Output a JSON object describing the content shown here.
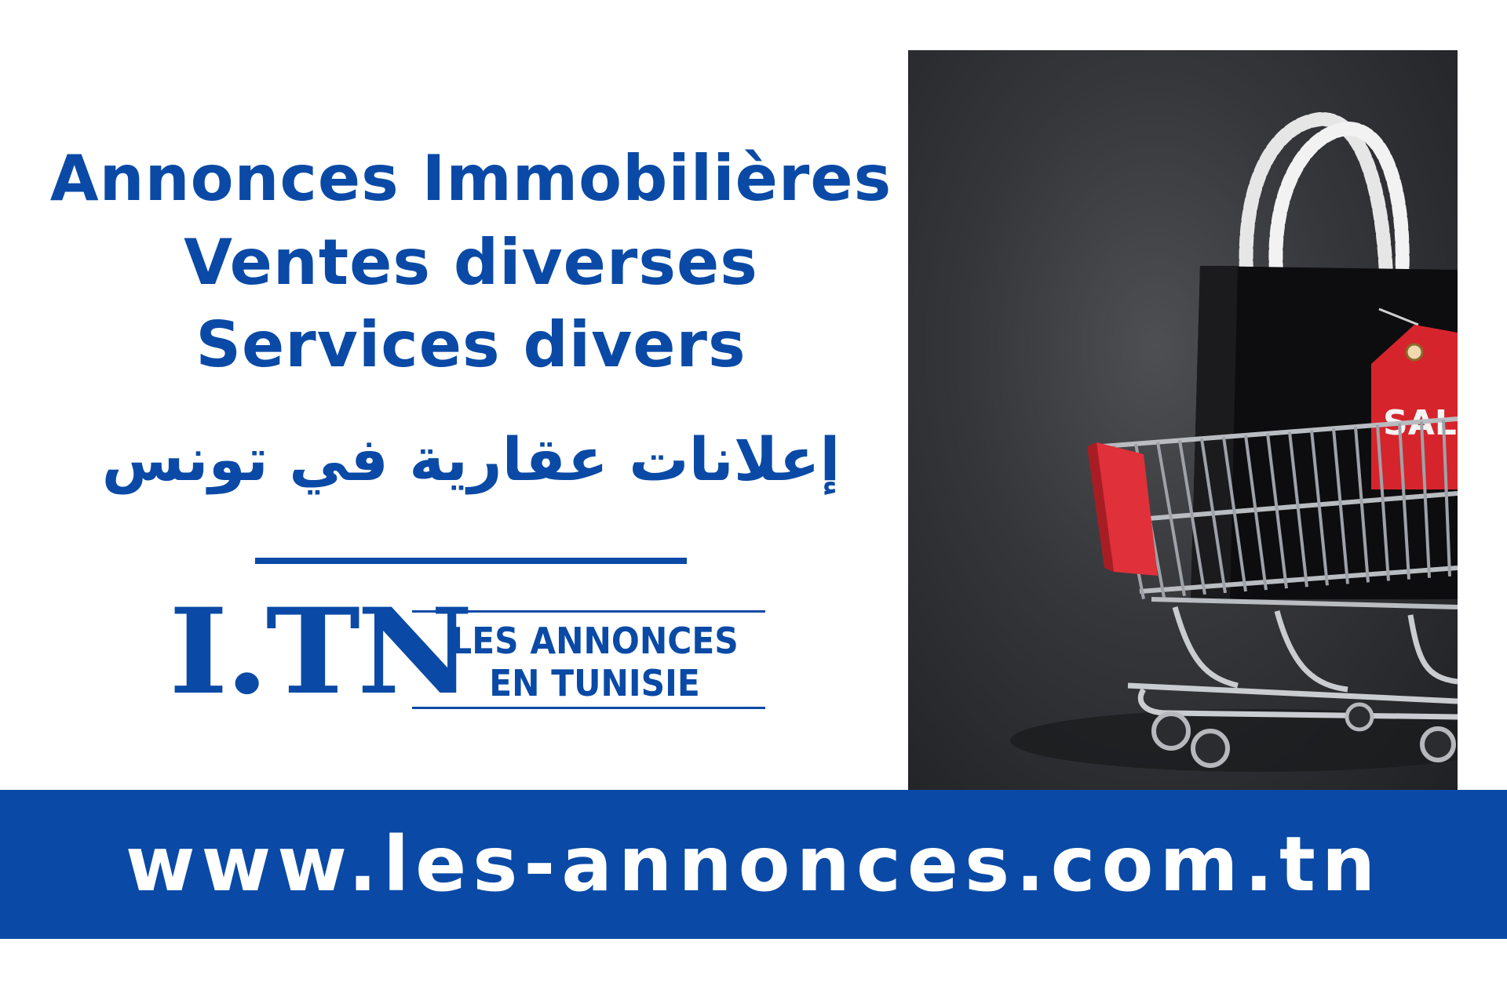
{
  "headline": {
    "line1": "Annonces Immobilières",
    "line2": "Ventes diverses",
    "line3": "Services divers",
    "arabic": "إعلانات عقارية في تونس"
  },
  "logo": {
    "mark": "I.TN",
    "line1": "LES ANNONCES",
    "line2": "EN TUNISIE"
  },
  "photo": {
    "tag_text": "SALE"
  },
  "footer": {
    "url": "www.les-annonces.com.tn"
  },
  "colors": {
    "brand_blue": "#0a4aa6",
    "tag_red": "#d6242c",
    "background": "#ffffff"
  }
}
